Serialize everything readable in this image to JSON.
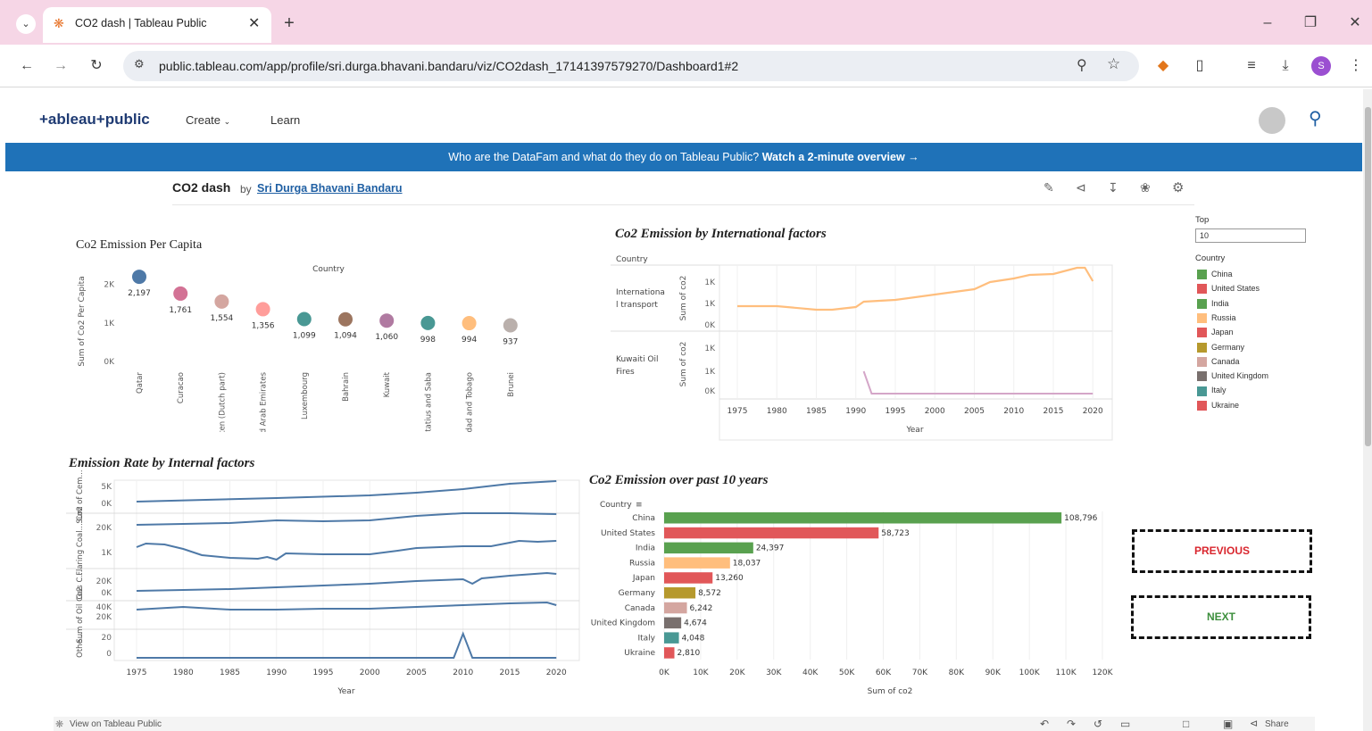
{
  "browser": {
    "tab_title": "CO2 dash | Tableau Public",
    "url": "public.tableau.com/app/profile/sri.durga.bhavani.bandaru/viz/CO2dash_17141397579270/Dashboard1#2",
    "profile_initial": "S"
  },
  "header": {
    "logo": "+ableau+public",
    "nav": [
      "Create",
      "Learn"
    ]
  },
  "banner": {
    "text": "Who are the DataFam and what do they do on Tableau Public?",
    "link": "Watch a 2-minute overview →"
  },
  "viz": {
    "title": "CO2 dash",
    "by": "by",
    "author": "Sri Durga Bhavani Bandaru"
  },
  "filter": {
    "top_label": "Top",
    "top_value": "10",
    "legend_title": "Country",
    "legend": [
      {
        "name": "China",
        "color": "#59a14f"
      },
      {
        "name": "United States",
        "color": "#e15759"
      },
      {
        "name": "India",
        "color": "#59a14f"
      },
      {
        "name": "Russia",
        "color": "#ffbe7d"
      },
      {
        "name": "Japan",
        "color": "#e15759"
      },
      {
        "name": "Germany",
        "color": "#b6992d"
      },
      {
        "name": "Canada",
        "color": "#d4a6a0"
      },
      {
        "name": "United Kingdom",
        "color": "#79706e"
      },
      {
        "name": "Italy",
        "color": "#499894"
      },
      {
        "name": "Ukraine",
        "color": "#e15759"
      }
    ]
  },
  "buttons": {
    "previous": "PREVIOUS",
    "next": "NEXT"
  },
  "footer": {
    "view_on": "View on Tableau Public",
    "share": "Share"
  },
  "chart_data": [
    {
      "id": "per_capita",
      "type": "scatter",
      "title": "Co2 Emission Per Capita",
      "header": "Country",
      "ylabel": "Sum of Co2 Per Capita",
      "yticks": [
        "2K",
        "1K",
        "0K"
      ],
      "categories": [
        "Qatar",
        "Curacao",
        "Sint Maarten (Dutch part)",
        "United Arab Emirates",
        "Luxembourg",
        "Bahrain",
        "Kuwait",
        "Bonaire Sint Eustatius and Saba",
        "Trinidad and Tobago",
        "Brunei"
      ],
      "values": [
        2197,
        1761,
        1554,
        1356,
        1099,
        1094,
        1060,
        998,
        994,
        937
      ],
      "labels": [
        "2,197",
        "1,761",
        "1,554",
        "1,356",
        "1,099",
        "1,094",
        "1,060",
        "998",
        "994",
        "937"
      ],
      "colors": [
        "#4e79a7",
        "#d37295",
        "#d4a6a0",
        "#ff9d9a",
        "#499894",
        "#9c755f",
        "#b07aa1",
        "#499894",
        "#ffbe7d",
        "#bab0ac"
      ],
      "ylim": [
        0,
        2500
      ]
    },
    {
      "id": "international",
      "type": "line",
      "title": "Co2 Emission by International factors",
      "row_header": "Country",
      "rows": [
        {
          "name": "Internationa l transport",
          "ylabel": "Sum of co2",
          "yticks": [
            "1K",
            "1K",
            "0K"
          ]
        },
        {
          "name": "Kuwaiti Oil Fires",
          "ylabel": "Sum of co2",
          "yticks": [
            "1K",
            "1K",
            "0K"
          ]
        }
      ],
      "xticks": [
        "1975",
        "1980",
        "1985",
        "1990",
        "1995",
        "2000",
        "2005",
        "2010",
        "2015",
        "2020"
      ],
      "xlabel": "Year"
    },
    {
      "id": "internal",
      "type": "line",
      "title": "Emission Rate by Internal factors",
      "rows": [
        {
          "ylabel": "Sum of Cem...",
          "yticks": [
            "5K",
            "0K"
          ]
        },
        {
          "ylabel": "Flaring Coal... Co2",
          "yticks": [
            "20K",
            "1K"
          ]
        },
        {
          "ylabel": "Gas C...",
          "yticks": [
            "20K",
            "0K"
          ]
        },
        {
          "ylabel": "Sum of Oil Co2",
          "yticks": [
            "40K",
            "20K"
          ]
        },
        {
          "ylabel": "Othe...",
          "yticks": [
            "20",
            "0"
          ]
        }
      ],
      "xticks": [
        "1975",
        "1980",
        "1985",
        "1990",
        "1995",
        "2000",
        "2005",
        "2010",
        "2015",
        "2020"
      ],
      "xlabel": "Year"
    },
    {
      "id": "past10",
      "type": "bar",
      "title": "Co2 Emission over past 10 years",
      "header": "Country",
      "categories": [
        "China",
        "United States",
        "India",
        "Russia",
        "Japan",
        "Germany",
        "Canada",
        "United Kingdom",
        "Italy",
        "Ukraine"
      ],
      "values": [
        108796,
        58723,
        24397,
        18037,
        13260,
        8572,
        6242,
        4674,
        4048,
        2810
      ],
      "labels": [
        "108,796",
        "58,723",
        "24,397",
        "18,037",
        "13,260",
        "8,572",
        "6,242",
        "4,674",
        "4,048",
        "2,810"
      ],
      "colors": [
        "#59a14f",
        "#e15759",
        "#59a14f",
        "#ffbe7d",
        "#e15759",
        "#b6992d",
        "#d4a6a0",
        "#79706e",
        "#499894",
        "#e15759"
      ],
      "xticks": [
        "0K",
        "10K",
        "20K",
        "30K",
        "40K",
        "50K",
        "60K",
        "70K",
        "80K",
        "90K",
        "100K",
        "110K",
        "120K"
      ],
      "xlim": [
        0,
        120000
      ],
      "xlabel": "Sum of co2"
    }
  ]
}
